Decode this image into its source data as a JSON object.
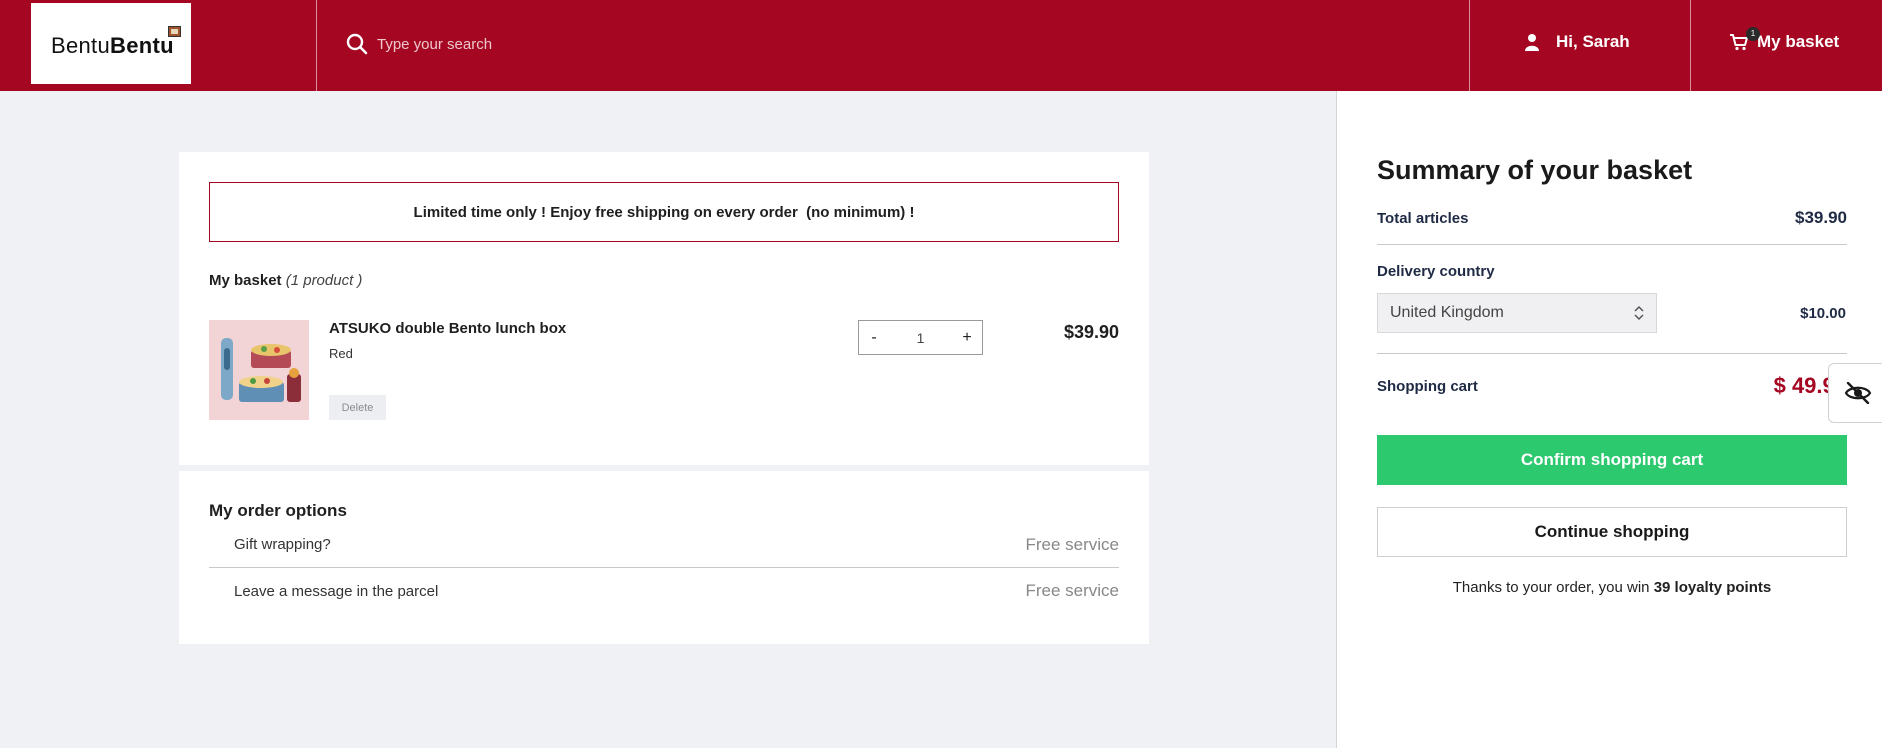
{
  "header": {
    "logo": {
      "part1": "Bentu",
      "part2": "Bentu"
    },
    "search": {
      "placeholder": "Type your search"
    },
    "user": {
      "greeting": "Hi, Sarah",
      "icon": "user-icon"
    },
    "basket": {
      "label": "My basket",
      "count": "1",
      "icon": "cart-icon"
    }
  },
  "promo": {
    "text": "Limited time only ! Enjoy free shipping on every order  (no minimum) !"
  },
  "basket": {
    "title": "My basket",
    "count_label": "(1 product )",
    "items": [
      {
        "name": "ATSUKO double Bento lunch box",
        "variant": "Red",
        "delete_label": "Delete",
        "minus": "-",
        "quantity": "1",
        "plus": "+",
        "price": "$39.90"
      }
    ]
  },
  "options": {
    "title": "My order options",
    "rows": [
      {
        "label": "Gift wrapping?",
        "value": "Free service"
      },
      {
        "label": "Leave a message in the parcel",
        "value": "Free service"
      }
    ]
  },
  "summary": {
    "title": "Summary of your basket",
    "total_articles_label": "Total articles",
    "total_articles_value": "$39.90",
    "delivery_country_label": "Delivery country",
    "delivery_country_value": "United Kingdom",
    "delivery_price": "$10.00",
    "shopping_cart_label": "Shopping cart",
    "shopping_cart_value": "$ 49.90",
    "confirm_label": "Confirm shopping cart",
    "continue_label": "Continue shopping",
    "loyalty_text": "Thanks to your order, you win ",
    "loyalty_points": "39 loyalty points"
  },
  "colors": {
    "brand": "#a50722",
    "confirm": "#2dc96e",
    "background": "#f0f1f5"
  },
  "accessibility": {
    "icon": "eye-off-icon"
  }
}
